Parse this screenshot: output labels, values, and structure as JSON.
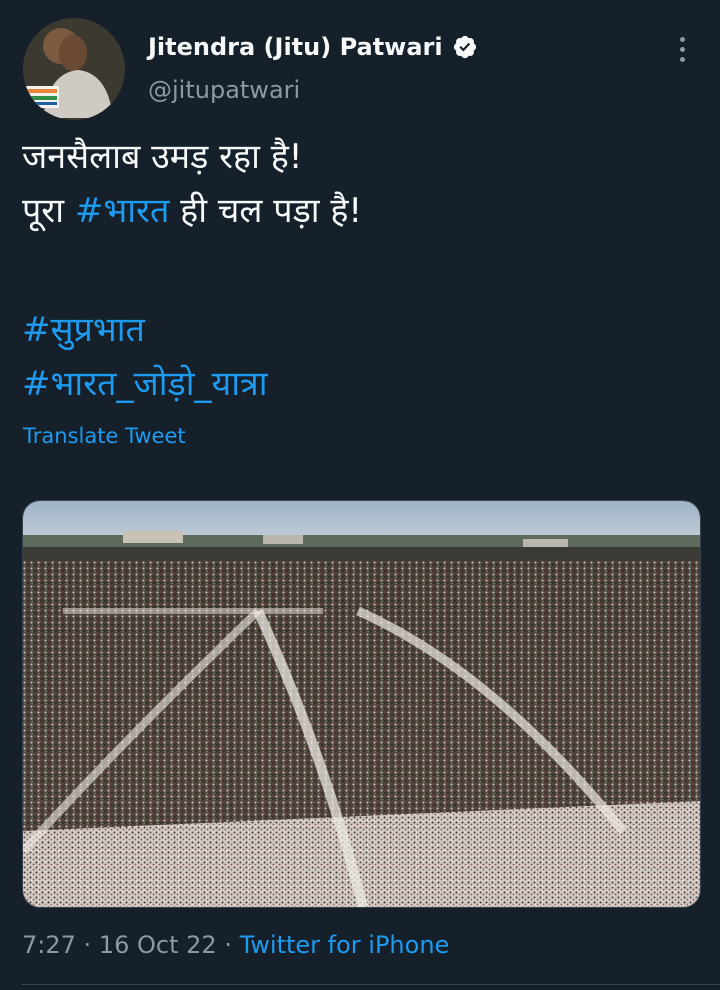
{
  "theme": {
    "background": "#15202b",
    "accent": "#1d9bf0",
    "secondary_text": "#8b98a5",
    "primary_text": "#f7f9f9"
  },
  "author": {
    "display_name": "Jitendra (Jitu) Patwari",
    "handle": "@jitupatwari",
    "verified": true,
    "avatar_icon": "profile-photo"
  },
  "tweet": {
    "line1": "जनसैलाब उमड़ रहा है!",
    "line2_prefix": "पूरा ",
    "line2_hashtag": "#भारत",
    "line2_suffix": " ही चल पड़ा है!",
    "hashtag1": "#सुप्रभात",
    "hashtag2": "#भारत_जोड़ो_यात्रा",
    "translate_label": "Translate Tweet"
  },
  "media": {
    "icon": "crowd-photo"
  },
  "meta": {
    "time": "7:27",
    "separator": "·",
    "date": "16 Oct 22",
    "source": "Twitter for iPhone"
  },
  "icons": {
    "more": "more-options-icon",
    "verified": "verified-badge-icon"
  }
}
